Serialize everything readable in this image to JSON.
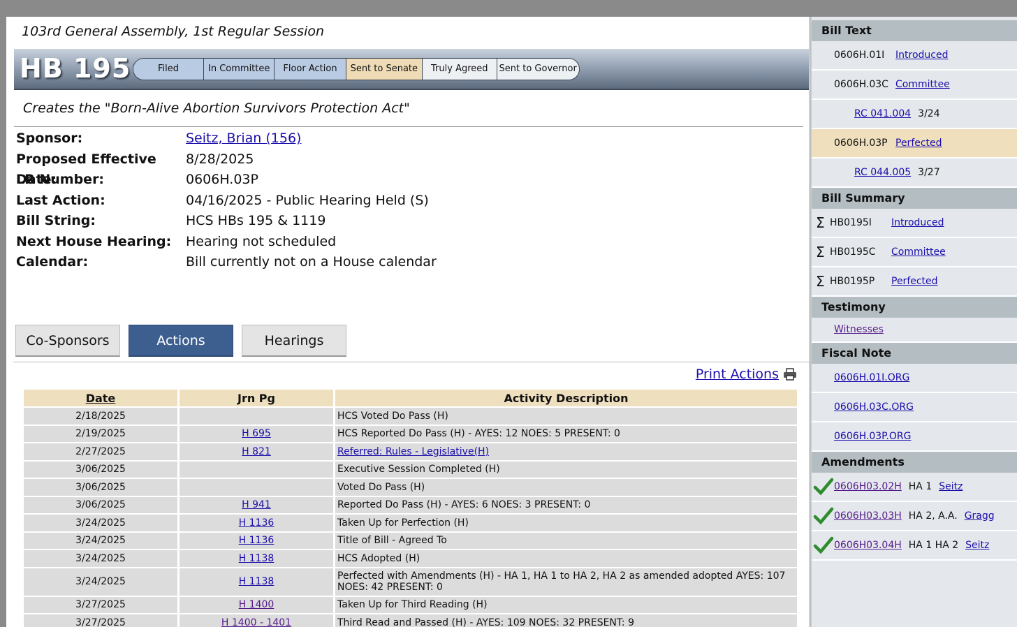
{
  "session": "103rd General Assembly, 1st Regular Session",
  "bill": {
    "number": "HB 195",
    "stages": [
      "Filed",
      "In Committee",
      "Floor Action",
      "Sent to Senate",
      "Truly Agreed",
      "Sent to Governor"
    ],
    "description": "Creates the \"Born-Alive Abortion Survivors Protection Act\""
  },
  "info": {
    "sponsor_label": "Sponsor:",
    "sponsor": "Seitz, Brian (156)",
    "eff_label": "Proposed Effective Date:",
    "eff": "8/28/2025",
    "lr_label": "LR Number:",
    "lr": "0606H.03P",
    "last_label": "Last Action:",
    "last": "04/16/2025 - Public Hearing Held (S)",
    "string_label": "Bill String:",
    "string": "HCS HBs 195 & 1119",
    "hearing_label": "Next House Hearing:",
    "hearing": "Hearing not scheduled",
    "cal_label": "Calendar:",
    "cal": "Bill currently not on a House calendar"
  },
  "tabs": [
    "Co-Sponsors",
    "Actions",
    "Hearings"
  ],
  "print_label": "Print Actions",
  "actions": {
    "headers": [
      "Date",
      "Jrn Pg",
      "Activity Description"
    ],
    "rows": [
      {
        "date": "2/18/2025",
        "jrn": "",
        "desc": "HCS Voted Do Pass (H)"
      },
      {
        "date": "2/19/2025",
        "jrn": "H 695",
        "desc": "HCS Reported Do Pass (H) - AYES: 12 NOES: 5 PRESENT: 0"
      },
      {
        "date": "2/27/2025",
        "jrn": "H 821",
        "desc": "Referred: Rules - Legislative(H)"
      },
      {
        "date": "3/06/2025",
        "jrn": "",
        "desc": "Executive Session Completed (H)"
      },
      {
        "date": "3/06/2025",
        "jrn": "",
        "desc": "Voted Do Pass (H)"
      },
      {
        "date": "3/06/2025",
        "jrn": "H 941",
        "desc": "Reported Do Pass (H) - AYES: 6 NOES: 3 PRESENT: 0"
      },
      {
        "date": "3/24/2025",
        "jrn": "H 1136",
        "desc": "Taken Up for Perfection (H)"
      },
      {
        "date": "3/24/2025",
        "jrn": "H 1136",
        "desc": "Title of Bill - Agreed To"
      },
      {
        "date": "3/24/2025",
        "jrn": "H 1138",
        "desc": "HCS Adopted (H)"
      },
      {
        "date": "3/24/2025",
        "jrn": "H 1138",
        "desc": "Perfected with Amendments (H) - HA 1, HA 1 to HA 2, HA 2 as amended adopted AYES: 107",
        "desc2": "NOES: 42 PRESENT: 0"
      },
      {
        "date": "3/27/2025",
        "jrn": "H 1400",
        "desc": "Taken Up for Third Reading (H)"
      },
      {
        "date": "3/27/2025",
        "jrn": "H 1400 - 1401",
        "desc": "Third Read and Passed (H) - AYES: 109 NOES: 32 PRESENT: 9"
      }
    ]
  },
  "side": {
    "bill_text_title": "Bill Text",
    "bill_text": [
      {
        "code": "0606H.01I",
        "link": "Introduced"
      },
      {
        "code": "0606H.03C",
        "link": "Committee"
      },
      {
        "rc": "RC 041.004",
        "date": "3/24"
      },
      {
        "code": "0606H.03P",
        "link": "Perfected"
      },
      {
        "rc": "RC 044.005",
        "date": "3/27"
      }
    ],
    "summary_title": "Bill Summary",
    "summary": [
      {
        "code": "HB0195I",
        "link": "Introduced"
      },
      {
        "code": "HB0195C",
        "link": "Committee"
      },
      {
        "code": "HB0195P",
        "link": "Perfected"
      }
    ],
    "testimony_title": "Testimony",
    "testimony_link": "Witnesses",
    "fiscal_title": "Fiscal Note",
    "fiscal": [
      "0606H.01I.ORG",
      "0606H.03C.ORG",
      "0606H.03P.ORG"
    ],
    "amend_title": "Amendments",
    "amendments": [
      {
        "code": "0606H03.02H",
        "ha": "HA 1",
        "sponsor": "Seitz"
      },
      {
        "code": "0606H03.03H",
        "ha": "HA 2, A.A.",
        "sponsor": "Gragg"
      },
      {
        "code": "0606H03.04H",
        "ha": "HA 1 HA 2",
        "sponsor": "Seitz"
      }
    ]
  }
}
